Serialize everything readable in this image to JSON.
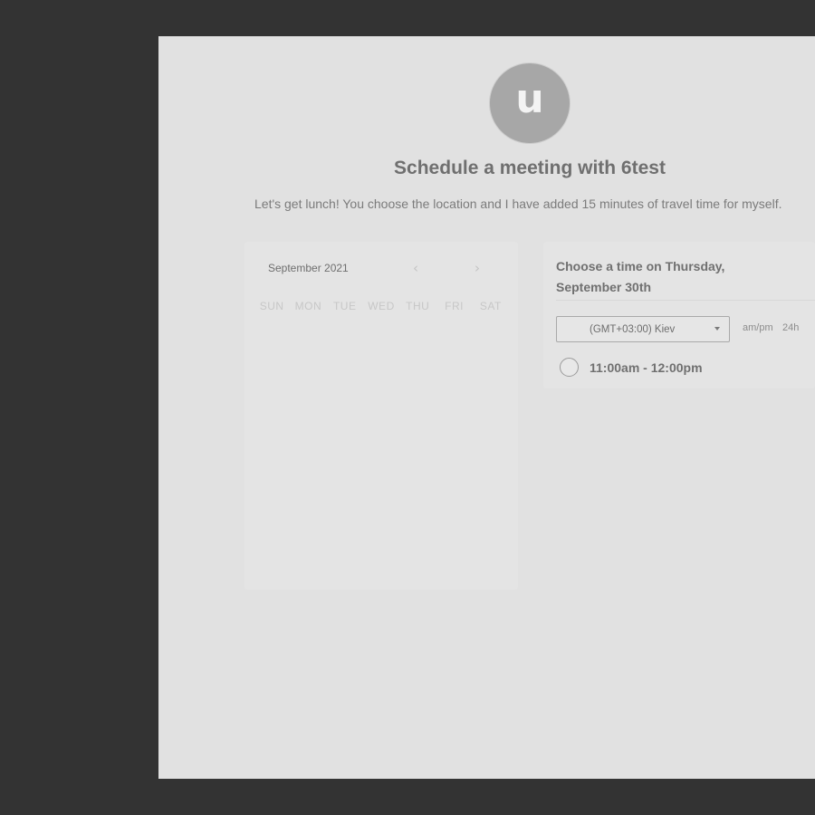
{
  "header": {
    "avatar_letter": "u",
    "title": "Schedule a meeting with 6test",
    "description": "Let's get lunch! You choose the location and I have added 15 minutes of travel time for myself."
  },
  "calendar": {
    "month_label": "September 2021",
    "prev_icon": "chevron-left-icon",
    "next_icon": "chevron-right-icon",
    "weekdays": [
      "SUN",
      "MON",
      "TUE",
      "WED",
      "THU",
      "FRI",
      "SAT"
    ],
    "weeks": [
      [
        "",
        "",
        "",
        "",
        "",
        "",
        ""
      ],
      [
        "",
        "",
        "",
        "",
        "",
        "",
        ""
      ],
      [
        "",
        "",
        "",
        "",
        "",
        "",
        ""
      ],
      [
        "",
        "",
        "",
        "",
        "",
        "",
        ""
      ],
      [
        "",
        "",
        "",
        "",
        "",
        "",
        ""
      ]
    ]
  },
  "time_panel": {
    "heading": "Choose a time on Thursday, September 30th",
    "timezone_value": "(GMT+03:00) Kiev",
    "format_ampm": "am/pm",
    "format_24h": "24h",
    "slots": [
      {
        "label": "11:00am - 12:00pm"
      }
    ]
  },
  "colors": {
    "background": "#333333",
    "panel": "#e1e1e1",
    "avatar": "#a7a7a7",
    "title_text": "#6f6f6f"
  }
}
